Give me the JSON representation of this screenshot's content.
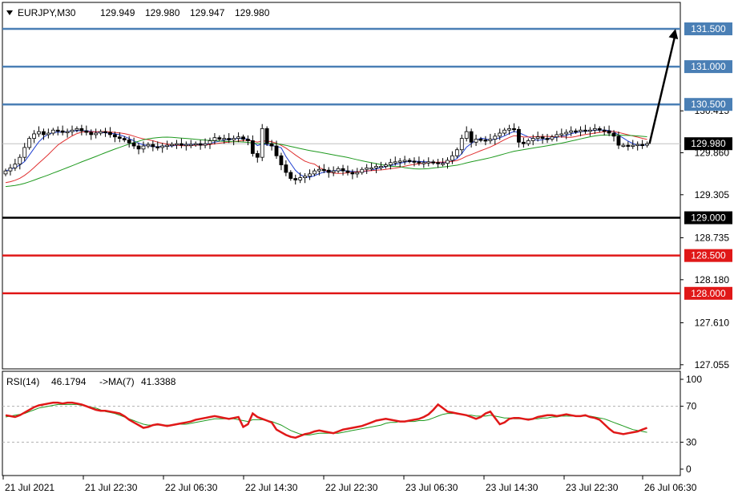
{
  "header": {
    "symbol_label": "EURJPY,M30",
    "ohlc": [
      "129.949",
      "129.980",
      "129.947",
      "129.980"
    ]
  },
  "colors": {
    "up_candle": "#ffffff",
    "down_candle": "#000000",
    "ma_fast": "#1f3fd1",
    "ma_mid": "#e03030",
    "ma_slow": "#1f9a1f",
    "level_blue": "#4a7fb5",
    "level_red": "#e01818",
    "level_black": "#000000",
    "rsi_line": "#e01818",
    "rsi_ma": "#1f9a1f"
  },
  "chart_data": [
    {
      "type": "candlestick",
      "title": "EURJPY,M30",
      "ylim": [
        127.0,
        131.85
      ],
      "y_ticks": [
        "130.415",
        "129.860",
        "129.305",
        "128.735",
        "128.180",
        "127.610",
        "127.055"
      ],
      "x_ticks": [
        "21 Jul 2021",
        "21 Jul 22:30",
        "22 Jul 06:30",
        "22 Jul 14:30",
        "22 Jul 22:30",
        "23 Jul 06:30",
        "23 Jul 14:30",
        "23 Jul 22:30",
        "26 Jul 06:30"
      ],
      "current_price": "129.980",
      "levels": [
        {
          "value": 131.5,
          "label": "131.500",
          "color": "blue"
        },
        {
          "value": 131.0,
          "label": "131.000",
          "color": "blue"
        },
        {
          "value": 130.5,
          "label": "130.500",
          "color": "blue"
        },
        {
          "value": 129.0,
          "label": "129.000",
          "color": "black"
        },
        {
          "value": 128.5,
          "label": "128.500",
          "color": "red"
        },
        {
          "value": 128.0,
          "label": "128.000",
          "color": "red"
        }
      ],
      "close_series": [
        129.62,
        129.66,
        129.71,
        129.8,
        129.93,
        130.05,
        130.11,
        130.14,
        130.1,
        130.12,
        130.16,
        130.15,
        130.13,
        130.14,
        130.16,
        130.18,
        130.15,
        130.13,
        130.1,
        130.12,
        130.14,
        130.13,
        130.1,
        130.07,
        130.05,
        130.03,
        129.99,
        129.95,
        129.91,
        129.95,
        129.97,
        129.94,
        129.93,
        129.95,
        129.96,
        129.97,
        129.98,
        129.96,
        129.97,
        129.97,
        129.98,
        129.96,
        129.98,
        130.02,
        130.06,
        130.04,
        130.05,
        130.03,
        130.05,
        130.07,
        130.04,
        130.02,
        129.85,
        129.8,
        130.18,
        129.98,
        129.95,
        129.82,
        129.7,
        129.6,
        129.52,
        129.5,
        129.53,
        129.55,
        129.58,
        129.62,
        129.64,
        129.63,
        129.6,
        129.62,
        129.65,
        129.62,
        129.6,
        129.58,
        129.6,
        129.64,
        129.66,
        129.66,
        129.68,
        129.68,
        129.7,
        129.73,
        129.74,
        129.75,
        129.76,
        129.75,
        129.74,
        129.73,
        129.73,
        129.74,
        129.73,
        129.72,
        129.72,
        129.76,
        129.82,
        129.9,
        130.05,
        130.14,
        130.0,
        130.04,
        130.03,
        130.02,
        130.04,
        130.08,
        130.12,
        130.16,
        130.18,
        130.17,
        130.0,
        129.98,
        130.02,
        130.05,
        130.07,
        130.05,
        130.04,
        130.07,
        130.1,
        130.11,
        130.13,
        130.15,
        130.14,
        130.16,
        130.15,
        130.16,
        130.18,
        130.16,
        130.15,
        130.12,
        130.08,
        129.96,
        129.96,
        129.95,
        129.96,
        129.97,
        129.96,
        129.98
      ],
      "moving_averages": [
        "fast (blue)",
        "mid (red)",
        "slow (green)"
      ],
      "forecast_arrow": {
        "from": 129.98,
        "to": 131.5
      }
    },
    {
      "type": "line",
      "title": "RSI(14) 46.1794 ->MA(7) 41.3388",
      "indicator_label": "RSI(14)",
      "indicator_value": "46.1794",
      "ma_label": "->MA(7)",
      "ma_value": "41.3388",
      "ylim": [
        0,
        100
      ],
      "y_ticks": [
        "100",
        "70",
        "30",
        "0"
      ],
      "dashed_levels": [
        70,
        30
      ],
      "rsi_series": [
        60,
        59,
        58,
        60,
        63,
        66,
        69,
        71,
        72,
        73,
        74,
        74,
        73,
        74,
        74,
        73,
        72,
        70,
        68,
        66,
        65,
        65,
        64,
        63,
        62,
        59,
        55,
        52,
        49,
        46,
        47,
        49,
        50,
        49,
        48,
        49,
        50,
        51,
        52,
        53,
        55,
        56,
        57,
        58,
        59,
        58,
        57,
        56,
        57,
        58,
        47,
        50,
        62,
        58,
        56,
        54,
        52,
        44,
        41,
        38,
        36,
        35,
        37,
        39,
        40,
        42,
        43,
        42,
        41,
        40,
        42,
        44,
        45,
        46,
        47,
        48,
        50,
        52,
        54,
        55,
        56,
        55,
        54,
        53,
        53,
        54,
        55,
        56,
        58,
        61,
        66,
        72,
        68,
        64,
        63,
        62,
        61,
        60,
        58,
        56,
        58,
        62,
        64,
        57,
        50,
        52,
        56,
        57,
        57,
        56,
        55,
        56,
        58,
        59,
        60,
        60,
        59,
        60,
        61,
        60,
        59,
        59,
        60,
        58,
        57,
        55,
        50,
        45,
        41,
        40,
        39,
        40,
        41,
        42,
        44,
        46
      ],
      "ma_series": [
        58,
        59,
        60,
        61,
        62,
        64,
        66,
        68,
        69,
        70,
        71,
        72,
        72,
        72,
        72,
        72,
        71,
        70,
        69,
        68,
        66,
        64,
        63,
        62,
        60,
        58,
        56,
        54,
        52,
        50,
        49,
        49,
        49,
        49,
        49,
        49,
        50,
        50,
        50,
        51,
        52,
        53,
        54,
        55,
        56,
        56,
        56,
        56,
        56,
        55,
        54,
        53,
        55,
        55,
        55,
        54,
        53,
        51,
        49,
        46,
        43,
        41,
        39,
        38,
        38,
        39,
        40,
        40,
        40,
        40,
        40,
        41,
        42,
        43,
        44,
        45,
        46,
        47,
        48,
        49,
        51,
        52,
        52,
        53,
        53,
        53,
        53,
        54,
        54,
        55,
        57,
        59,
        61,
        62,
        62,
        62,
        61,
        60,
        60,
        59,
        59,
        59,
        60,
        59,
        58,
        57,
        57,
        56,
        56,
        56,
        56,
        56,
        56,
        57,
        57,
        58,
        58,
        59,
        59,
        59,
        59,
        59,
        59,
        59,
        58,
        57,
        56,
        54,
        52,
        50,
        48,
        46,
        44,
        43,
        42,
        41
      ]
    }
  ]
}
